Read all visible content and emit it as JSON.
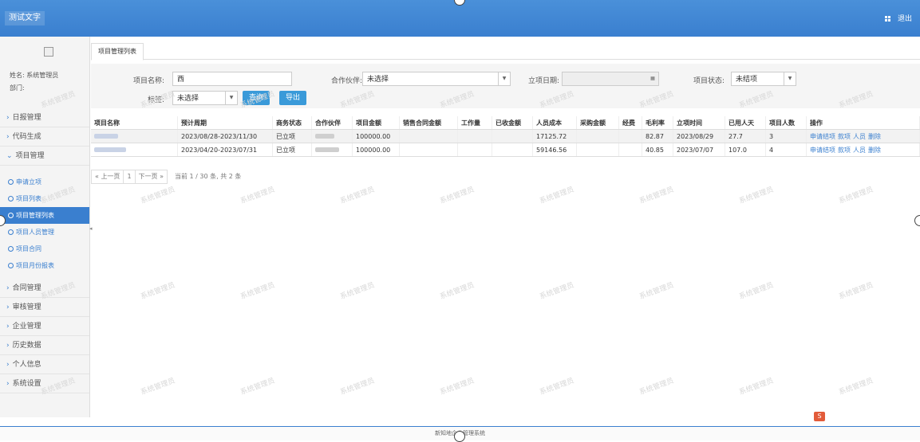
{
  "header": {
    "app_title": "测试文字",
    "grid_icon": "grid-icon",
    "logout_label": "退出"
  },
  "sidebar": {
    "avatar_icon": "broken-image-icon",
    "user_name": "姓名: 系统管理员",
    "department": "部门:",
    "menu_top": [
      {
        "label": "日报管理"
      },
      {
        "label": "代码生成"
      },
      {
        "label": "项目管理"
      }
    ],
    "submenu": [
      {
        "label": "申请立项"
      },
      {
        "label": "项目列表"
      },
      {
        "label": "项目管理列表",
        "active": true
      },
      {
        "label": "项目人员管理"
      },
      {
        "label": "项目合同"
      },
      {
        "label": "项目月份报表"
      }
    ],
    "menu_bottom": [
      {
        "label": "合同管理"
      },
      {
        "label": "审核管理"
      },
      {
        "label": "企业管理"
      },
      {
        "label": "历史数据"
      },
      {
        "label": "个人信息"
      },
      {
        "label": "系统设置"
      }
    ]
  },
  "tabs": [
    {
      "label": "项目管理列表"
    }
  ],
  "filters": {
    "project_name_label": "项目名称:",
    "project_name_value": "西",
    "partner_label": "合作伙伴:",
    "partner_value": "未选择",
    "start_date_label": "立项日期:",
    "start_date_value": "",
    "status_label": "项目状态:",
    "status_value": "未结项",
    "tag_label": "标签:",
    "tag_value": "未选择",
    "search_label": "查询",
    "export_label": "导出"
  },
  "table": {
    "headers": [
      "项目名称",
      "预计周期",
      "商务状态",
      "合作伙伴",
      "项目金额",
      "销售合同金额",
      "工作量",
      "已收金额",
      "人员成本",
      "采购金额",
      "经费",
      "毛利率",
      "立项时间",
      "已用人天",
      "项目人数",
      "操作"
    ],
    "rows": [
      {
        "period": "2023/08/28-2023/11/30",
        "status": "已立项",
        "amount": "100000.00",
        "sales": "",
        "workload": "",
        "received": "",
        "cost": "17125.72",
        "purchase": "",
        "funding": "",
        "margin": "82.87",
        "date": "2023/08/29",
        "days": "27.7",
        "people": "3"
      },
      {
        "period": "2023/04/20-2023/07/31",
        "status": "已立项",
        "amount": "100000.00",
        "sales": "",
        "workload": "",
        "received": "",
        "cost": "59146.56",
        "purchase": "",
        "funding": "",
        "margin": "40.85",
        "date": "2023/07/07",
        "days": "107.0",
        "people": "4"
      }
    ],
    "actions": [
      "申请结项",
      "款项",
      "人员",
      "删除"
    ]
  },
  "pager": {
    "prev": "« 上一页",
    "page": "1",
    "next": "下一页 »",
    "info": "当前 1 / 30 条, 共 2 条"
  },
  "watermark": "系统管理员",
  "footer": "新知地企业管理系统"
}
